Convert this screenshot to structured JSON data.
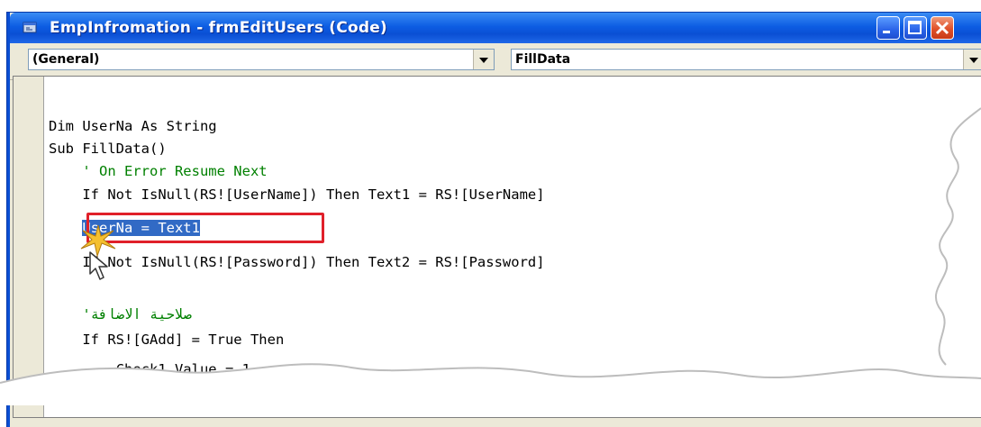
{
  "window": {
    "title": "EmpInfromation - frmEditUsers (Code)",
    "icon": "code-window-icon",
    "buttons": [
      "minimize-icon",
      "maximize-icon",
      "close-icon"
    ]
  },
  "combos": {
    "object": "(General)",
    "procedure": "FillData"
  },
  "code_lines": [
    "Dim UserNa As String",
    "Sub FillData()",
    "    ' On Error Resume Next",
    "    If Not IsNull(RS![UserName]) Then Text1 = RS![UserName]",
    "    UserNa = Text1",
    "    If Not IsNull(RS![Password]) Then Text2 = RS![Password]",
    "",
    "    'صلاحية الاضافة",
    "    If RS![GAdd] = True Then",
    "        Check1.Value = 1"
  ],
  "selected_line_index": 4,
  "colors": {
    "comment": "#008000",
    "selection": "#316ac5",
    "highlight_box": "#e0202a",
    "titlebar": "#0a4fd4"
  }
}
